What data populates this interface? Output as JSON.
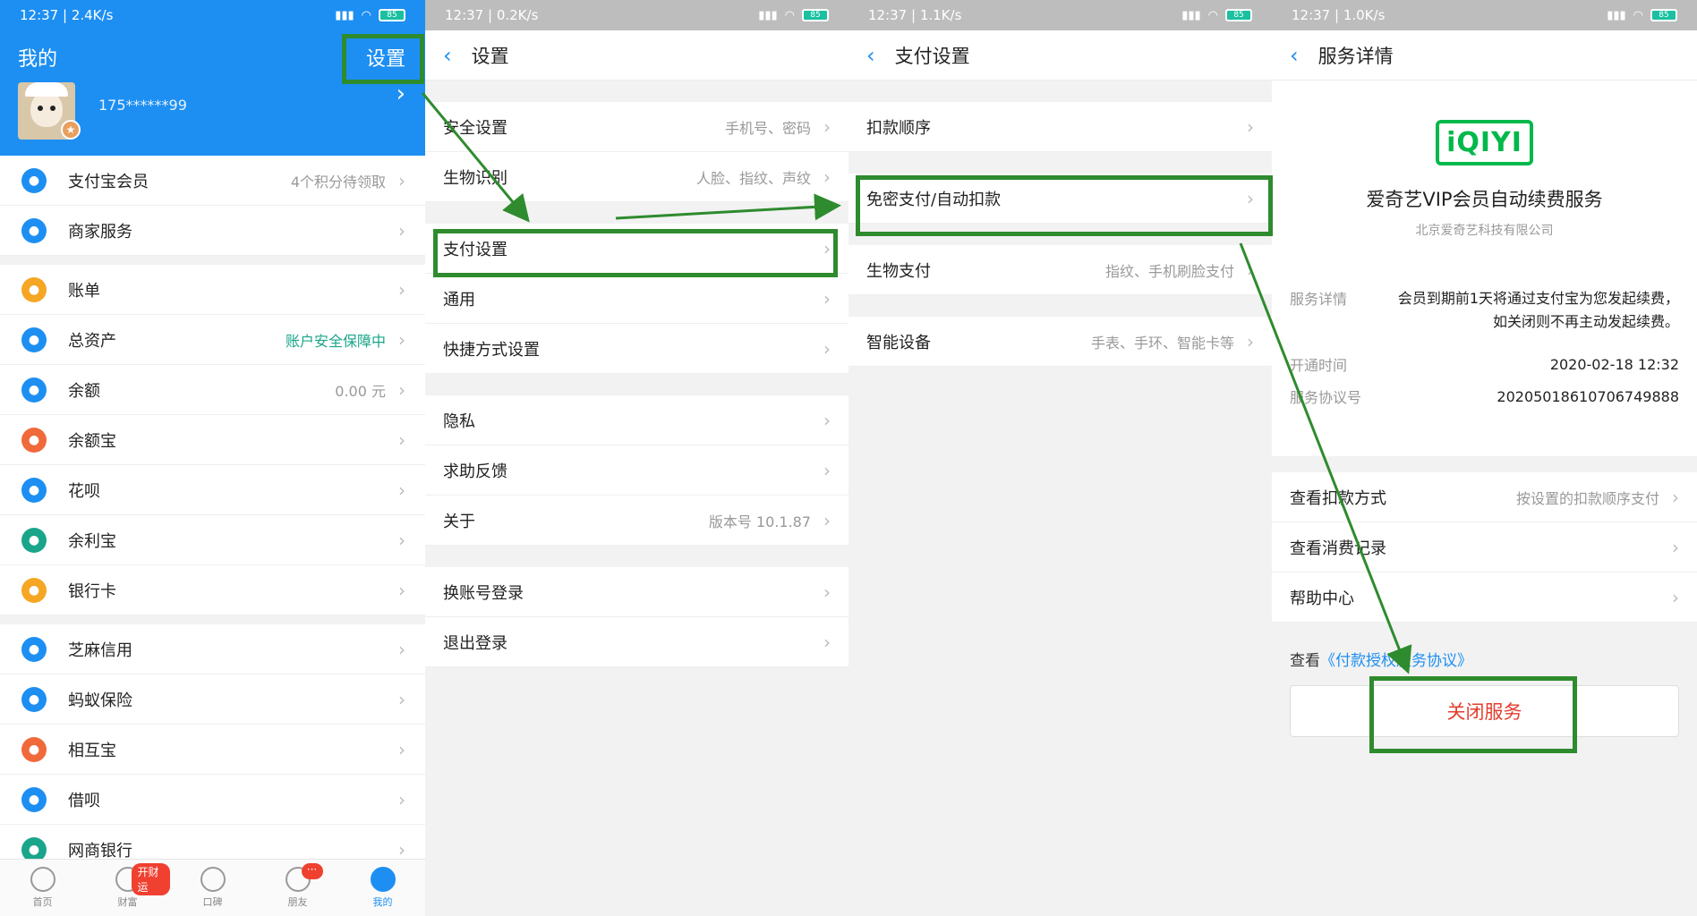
{
  "status_bars": [
    {
      "time": "12:37 | 2.4K/s",
      "battery": "85"
    },
    {
      "time": "12:37 | 0.2K/s",
      "battery": "85"
    },
    {
      "time": "12:37 | 1.1K/s",
      "battery": "85"
    },
    {
      "time": "12:37 | 1.0K/s",
      "battery": "85"
    }
  ],
  "mine": {
    "title": "我的",
    "settings_label": "设置",
    "phone": "175******99",
    "groups": [
      [
        {
          "label": "支付宝会员",
          "value": "4个积分待领取",
          "icon_color": "#1d8ff2",
          "icon": "crown-icon"
        },
        {
          "label": "商家服务",
          "value": "",
          "icon_color": "#1d8ff2",
          "icon": "store-icon"
        }
      ],
      [
        {
          "label": "账单",
          "value": "",
          "icon_color": "#f5a623",
          "icon": "bill-icon"
        },
        {
          "label": "总资产",
          "value": "账户安全保障中",
          "icon_color": "#1d8ff2",
          "icon": "pie-icon",
          "value_green": true
        },
        {
          "label": "余额",
          "value": "0.00 元",
          "icon_color": "#1d8ff2",
          "icon": "yuan-icon"
        },
        {
          "label": "余额宝",
          "value": "",
          "icon_color": "#f0693a",
          "icon": "moneybag-icon"
        },
        {
          "label": "花呗",
          "value": "",
          "icon_color": "#1d8ff2",
          "icon": "huabei-icon"
        },
        {
          "label": "余利宝",
          "value": "",
          "icon_color": "#1aa58b",
          "icon": "yulibao-icon"
        },
        {
          "label": "银行卡",
          "value": "",
          "icon_color": "#f5a623",
          "icon": "card-icon"
        }
      ],
      [
        {
          "label": "芝麻信用",
          "value": "",
          "icon_color": "#1d8ff2",
          "icon": "drop-icon"
        },
        {
          "label": "蚂蚁保险",
          "value": "",
          "icon_color": "#1d8ff2",
          "icon": "shield-icon"
        },
        {
          "label": "相互宝",
          "value": "",
          "icon_color": "#f0693a",
          "icon": "heart-icon"
        },
        {
          "label": "借呗",
          "value": "",
          "icon_color": "#1d8ff2",
          "icon": "jiebei-icon"
        },
        {
          "label": "网商银行",
          "value": "",
          "icon_color": "#1aa58b",
          "icon": "bank-icon"
        }
      ]
    ],
    "tabs": [
      {
        "label": "首页",
        "icon": "home-icon"
      },
      {
        "label": "财富",
        "icon": "wealth-icon",
        "badge": "开财运"
      },
      {
        "label": "口碑",
        "icon": "koubei-icon"
      },
      {
        "label": "朋友",
        "icon": "friends-icon",
        "badge": "···"
      },
      {
        "label": "我的",
        "icon": "user-icon"
      }
    ]
  },
  "settings": {
    "title": "设置",
    "groups": [
      [
        {
          "label": "安全设置",
          "value": "手机号、密码"
        },
        {
          "label": "生物识别",
          "value": "人脸、指纹、声纹"
        }
      ],
      [
        {
          "label": "支付设置",
          "value": ""
        },
        {
          "label": "通用",
          "value": ""
        },
        {
          "label": "快捷方式设置",
          "value": ""
        }
      ],
      [
        {
          "label": "隐私",
          "value": ""
        },
        {
          "label": "求助反馈",
          "value": ""
        },
        {
          "label": "关于",
          "value": "版本号 10.1.87"
        }
      ],
      [
        {
          "label": "换账号登录",
          "value": ""
        },
        {
          "label": "退出登录",
          "value": ""
        }
      ]
    ]
  },
  "pay_settings": {
    "title": "支付设置",
    "groups": [
      [
        {
          "label": "扣款顺序",
          "value": ""
        }
      ],
      [
        {
          "label": "免密支付/自动扣款",
          "value": ""
        }
      ],
      [
        {
          "label": "生物支付",
          "value": "指纹、手机刷脸支付"
        }
      ],
      [
        {
          "label": "智能设备",
          "value": "手表、手环、智能卡等"
        }
      ]
    ]
  },
  "service": {
    "title": "服务详情",
    "logo_text": "iQIYI",
    "name": "爱奇艺VIP会员自动续费服务",
    "company": "北京爱奇艺科技有限公司",
    "details": [
      {
        "key": "服务详情",
        "value": "会员到期前1天将通过支付宝为您发起续费，如关闭则不再主动发起续费。"
      },
      {
        "key": "开通时间",
        "value": "2020-02-18 12:32"
      },
      {
        "key": "服务协议号",
        "value": "20205018610706749888"
      }
    ],
    "actions": [
      {
        "label": "查看扣款方式",
        "value": "按设置的扣款顺序支付"
      },
      {
        "label": "查看消费记录",
        "value": ""
      },
      {
        "label": "帮助中心",
        "value": ""
      }
    ],
    "agreement_prefix": "查看",
    "agreement_link": "《付款授权服务协议》",
    "close_label": "关闭服务"
  },
  "colors": {
    "alipay_blue": "#1d8ff2",
    "highlight_green": "#2e8b2e",
    "danger_red": "#e33d2e"
  }
}
